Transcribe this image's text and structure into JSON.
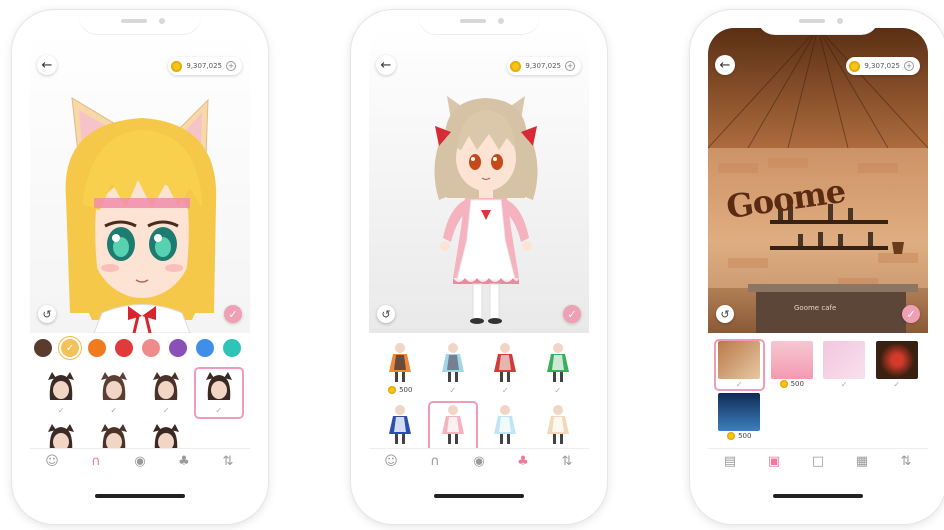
{
  "phones": [
    {
      "balance": "9,307,025",
      "swatches": [
        "#5a3b2e",
        "#f5c15a",
        "#f07a1e",
        "#e03a3a",
        "#f08b8b",
        "#8b4fb8",
        "#3f8fe8",
        "#2fc4b8"
      ],
      "selected_swatch": 1,
      "items": [
        {
          "name": "hair-style-1",
          "price": "",
          "selected": false
        },
        {
          "name": "hair-style-2",
          "price": "",
          "selected": false
        },
        {
          "name": "hair-style-3",
          "price": "",
          "selected": false
        },
        {
          "name": "hair-style-4",
          "price": "",
          "selected": true
        },
        {
          "name": "hair-style-5",
          "price": "",
          "selected": false
        },
        {
          "name": "hair-style-6",
          "price": "",
          "selected": false
        },
        {
          "name": "hair-style-7",
          "price": "",
          "selected": false
        }
      ],
      "tabs": [
        "face-icon",
        "hair-icon",
        "eye-icon",
        "outfit-icon",
        "sort-icon"
      ],
      "active_tab": 1
    },
    {
      "balance": "9,307,025",
      "items": [
        {
          "price": "500",
          "selected": false
        },
        {
          "price": "",
          "selected": false
        },
        {
          "price": "",
          "selected": false
        },
        {
          "price": "",
          "selected": false
        },
        {
          "price": "500",
          "selected": false
        },
        {
          "price": "",
          "selected": true
        },
        {
          "price": "500",
          "selected": false
        },
        {
          "price": "500",
          "selected": false
        }
      ],
      "tabs": [
        "face-icon",
        "hair-icon",
        "eye-icon",
        "outfit-icon",
        "sort-icon"
      ],
      "active_tab": 3
    },
    {
      "balance": "9,307,025",
      "sign_text": "Goome",
      "counter_text": "Goome cafe",
      "items": [
        {
          "price": "",
          "selected": true
        },
        {
          "price": "500",
          "selected": false
        },
        {
          "price": "",
          "selected": false
        },
        {
          "price": "",
          "selected": false
        },
        {
          "price": "500",
          "selected": false
        }
      ],
      "tabs": [
        "bg-shop-icon",
        "frame-icon",
        "board-icon",
        "window-icon",
        "sort-icon"
      ],
      "active_tab": 1
    }
  ]
}
